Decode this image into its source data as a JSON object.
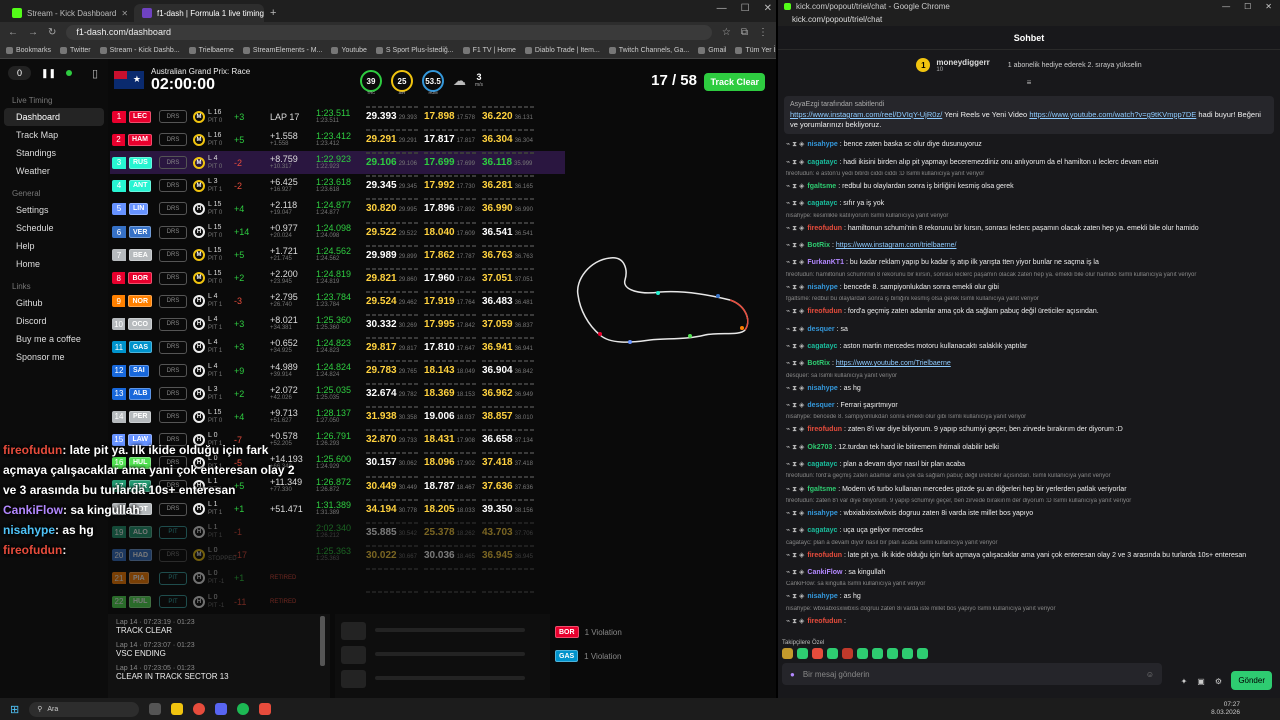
{
  "left_window": {
    "tabs": [
      {
        "label": "Stream - Kick Dashboard",
        "color": "#53fc18"
      },
      {
        "label": "f1-dash | Formula 1 live timing",
        "color": "#6f42c1"
      }
    ],
    "url": "f1-dash.com/dashboard",
    "bookmarks": [
      "Bookmarks",
      "Twitter",
      "Stream - Kick Dashb...",
      "Trielbaerne",
      "StreamElements - M...",
      "Youtube",
      "S Sport Plus-İstediğ...",
      "F1 TV | Home",
      "Diablo Trade | Item...",
      "Twitch Channels, Ga...",
      "Gmail",
      "Tüm Yer İşaretleri"
    ],
    "win_controls": [
      "—",
      "☐",
      "✕"
    ]
  },
  "sidebar": {
    "counter": "0",
    "live_timing": "Live Timing",
    "items": [
      "Dashboard",
      "Track Map",
      "Standings",
      "Weather"
    ],
    "general": "General",
    "general_items": [
      "Settings",
      "Schedule",
      "Help",
      "Home"
    ],
    "links": "Links",
    "link_items": [
      "Github",
      "Discord",
      "Buy me a coffee",
      "Sponsor me"
    ]
  },
  "race": {
    "name": "Australian Grand Prix: Race",
    "time": "02:00:00",
    "gauges": [
      {
        "value": "39",
        "label": "TRC"
      },
      {
        "value": "25",
        "label": "AIR"
      },
      {
        "value": "53.5",
        "label": "HUM"
      }
    ],
    "wind_value": "3",
    "wind_unit": "m/s",
    "laps": "17 / 58",
    "track_status": "Track Clear"
  },
  "drivers": [
    {
      "pos": "1",
      "code": "LEC",
      "color": "#e8002d",
      "drs": "DRS",
      "tyre": "M",
      "lap": "L 16",
      "pit": "PIT 0",
      "gain": "+3",
      "gap": "LAP 17",
      "gap2": "",
      "lt": "1:23.511",
      "lt2": "1:23.511",
      "s1": "29.393",
      "s1b": "29.393",
      "s2": "17.898",
      "s2b": "17.578",
      "s3": "36.220",
      "s3b": "36.131"
    },
    {
      "pos": "2",
      "code": "HAM",
      "color": "#e8002d",
      "drs": "DRS",
      "tyre": "M",
      "lap": "L 16",
      "pit": "PIT 0",
      "gain": "+5",
      "gap": "+1.558",
      "gap2": "+1.558",
      "lt": "1:23.412",
      "lt2": "1:23.412",
      "s1": "29.291",
      "s1b": "29.291",
      "s2": "17.817",
      "s2b": "17.817",
      "s3": "36.304",
      "s3b": "36.304"
    },
    {
      "pos": "3",
      "code": "RUS",
      "color": "#27f4d2",
      "drs": "DRS",
      "tyre": "M",
      "lap": "L 4",
      "pit": "PIT 0",
      "gain": "-2",
      "gap": "+8.759",
      "gap2": "+10.317",
      "lt": "1:22.923",
      "lt2": "1:22.923",
      "s1": "29.106",
      "s1b": "29.106",
      "s2": "17.699",
      "s2b": "17.699",
      "s3": "36.118",
      "s3b": "35.999"
    },
    {
      "pos": "4",
      "code": "ANT",
      "color": "#27f4d2",
      "drs": "DRS",
      "tyre": "M",
      "lap": "L 3",
      "pit": "PIT 1",
      "gain": "-2",
      "gap": "+6.425",
      "gap2": "+16.927",
      "lt": "1:23.618",
      "lt2": "1:23.618",
      "s1": "29.345",
      "s1b": "29.345",
      "s2": "17.992",
      "s2b": "17.730",
      "s3": "36.281",
      "s3b": "36.165"
    },
    {
      "pos": "5",
      "code": "LIN",
      "color": "#6692ff",
      "drs": "DRS",
      "tyre": "H",
      "lap": "L 15",
      "pit": "PIT 0",
      "gain": "+4",
      "gap": "+2.118",
      "gap2": "+19.047",
      "lt": "1:24.877",
      "lt2": "1:24.877",
      "s1": "30.820",
      "s1b": "29.995",
      "s2": "17.896",
      "s2b": "17.892",
      "s3": "36.990",
      "s3b": "36.990"
    },
    {
      "pos": "6",
      "code": "VER",
      "color": "#3671c6",
      "drs": "DRS",
      "tyre": "H",
      "lap": "L 15",
      "pit": "PIT 0",
      "gain": "+14",
      "gap": "+0.977",
      "gap2": "+20.024",
      "lt": "1:24.098",
      "lt2": "1:24.098",
      "s1": "29.522",
      "s1b": "29.522",
      "s2": "18.040",
      "s2b": "17.609",
      "s3": "36.541",
      "s3b": "36.541"
    },
    {
      "pos": "7",
      "code": "BEA",
      "color": "#b6babd",
      "drs": "DRS",
      "tyre": "M",
      "lap": "L 15",
      "pit": "PIT 0",
      "gain": "+5",
      "gap": "+1.721",
      "gap2": "+21.745",
      "lt": "1:24.562",
      "lt2": "1:24.562",
      "s1": "29.989",
      "s1b": "29.899",
      "s2": "17.862",
      "s2b": "17.787",
      "s3": "36.763",
      "s3b": "36.763"
    },
    {
      "pos": "8",
      "code": "BOR",
      "color": "#e8002d",
      "drs": "DRS",
      "tyre": "M",
      "lap": "L 15",
      "pit": "PIT 0",
      "gain": "+2",
      "gap": "+2.200",
      "gap2": "+23.945",
      "lt": "1:24.819",
      "lt2": "1:24.819",
      "s1": "29.821",
      "s1b": "29.860",
      "s2": "17.960",
      "s2b": "17.824",
      "s3": "37.051",
      "s3b": "37.051"
    },
    {
      "pos": "9",
      "code": "NOR",
      "color": "#ff8000",
      "drs": "DRS",
      "tyre": "H",
      "lap": "L 4",
      "pit": "PIT 1",
      "gain": "-3",
      "gap": "+2.795",
      "gap2": "+26.740",
      "lt": "1:23.784",
      "lt2": "1:23.784",
      "s1": "29.524",
      "s1b": "29.462",
      "s2": "17.919",
      "s2b": "17.764",
      "s3": "36.483",
      "s3b": "36.481"
    },
    {
      "pos": "10",
      "code": "OCO",
      "color": "#b6babd",
      "drs": "DRS",
      "tyre": "H",
      "lap": "L 4",
      "pit": "PIT 1",
      "gain": "+3",
      "gap": "+8.021",
      "gap2": "+34.381",
      "lt": "1:25.360",
      "lt2": "1:25.360",
      "s1": "30.332",
      "s1b": "30.269",
      "s2": "17.995",
      "s2b": "17.842",
      "s3": "37.059",
      "s3b": "36.837"
    },
    {
      "pos": "11",
      "code": "GAS",
      "color": "#0093cc",
      "drs": "DRS",
      "tyre": "H",
      "lap": "L 4",
      "pit": "PIT 1",
      "gain": "+3",
      "gap": "+0.652",
      "gap2": "+34.925",
      "lt": "1:24.823",
      "lt2": "1:24.823",
      "s1": "29.817",
      "s1b": "29.817",
      "s2": "17.810",
      "s2b": "17.647",
      "s3": "36.941",
      "s3b": "36.941"
    },
    {
      "pos": "12",
      "code": "SAI",
      "color": "#1868db",
      "drs": "DRS",
      "tyre": "H",
      "lap": "L 4",
      "pit": "PIT 1",
      "gain": "+9",
      "gap": "+4.989",
      "gap2": "+39.914",
      "lt": "1:24.824",
      "lt2": "1:24.824",
      "s1": "29.783",
      "s1b": "29.765",
      "s2": "18.143",
      "s2b": "18.049",
      "s3": "36.904",
      "s3b": "36.842"
    },
    {
      "pos": "13",
      "code": "ALB",
      "color": "#1868db",
      "drs": "DRS",
      "tyre": "H",
      "lap": "L 3",
      "pit": "PIT 1",
      "gain": "+2",
      "gap": "+2.072",
      "gap2": "+42.026",
      "lt": "1:25.035",
      "lt2": "1:25.035",
      "s1": "32.674",
      "s1b": "29.782",
      "s2": "18.369",
      "s2b": "18.153",
      "s3": "36.962",
      "s3b": "36.949"
    },
    {
      "pos": "14",
      "code": "PER",
      "color": "#b6babd",
      "drs": "DRS",
      "tyre": "H",
      "lap": "L 15",
      "pit": "PIT 0",
      "gain": "+4",
      "gap": "+9.713",
      "gap2": "+51.627",
      "lt": "1:28.137",
      "lt2": "1:27.050",
      "s1": "31.938",
      "s1b": "30.358",
      "s2": "19.006",
      "s2b": "18.037",
      "s3": "38.857",
      "s3b": "38.010"
    },
    {
      "pos": "15",
      "code": "LAW",
      "color": "#6692ff",
      "drs": "DRS",
      "tyre": "H",
      "lap": "L 0",
      "pit": "PIT 1",
      "gain": "-7",
      "gap": "+0.578",
      "gap2": "+52.205",
      "lt": "1:26.791",
      "lt2": "1:26.293",
      "s1": "32.870",
      "s1b": "29.733",
      "s2": "18.431",
      "s2b": "17.908",
      "s3": "36.658",
      "s3b": "37.134"
    },
    {
      "pos": "16",
      "code": "HUL",
      "color": "#52e252",
      "drs": "DRS",
      "tyre": "H",
      "lap": "L 0",
      "pit": "PIT 1",
      "gain": "-5",
      "gap": "+14.193",
      "gap2": "+66.349",
      "lt": "1:25.600",
      "lt2": "1:24.929",
      "s1": "30.157",
      "s1b": "30.062",
      "s2": "18.096",
      "s2b": "17.902",
      "s3": "37.418",
      "s3b": "37.418"
    },
    {
      "pos": "17",
      "code": "STR",
      "color": "#229971",
      "drs": "DRS",
      "tyre": "H",
      "lap": "L 1",
      "pit": "PIT 1",
      "gain": "+5",
      "gap": "+11.349",
      "gap2": "+77.330",
      "lt": "1:26.872",
      "lt2": "1:26.872",
      "s1": "30.449",
      "s1b": "30.449",
      "s2": "18.787",
      "s2b": "18.467",
      "s3": "37.636",
      "s3b": "37.636"
    },
    {
      "pos": "18",
      "code": "BOT",
      "color": "#b6babd",
      "drs": "DRS",
      "tyre": "H",
      "lap": "L 1",
      "pit": "PIT 1",
      "gain": "+1",
      "gap": "+51.471",
      "lt2": "1:31.389",
      "gap2": "",
      "lt": "1:31.389",
      "s1": "34.194",
      "s1b": "30.778",
      "s2": "18.205",
      "s2b": "18.033",
      "s3": "39.350",
      "s3b": "38.156"
    },
    {
      "pos": "19",
      "code": "ALO",
      "color": "#229971",
      "drs": "PIT",
      "tyre": "H",
      "lap": "L 1",
      "pit": "PIT 1",
      "gain": "-1",
      "gap": "",
      "gap2": "",
      "lt": "2:02.340",
      "lt2": "1:26.212",
      "s1": "35.885",
      "s1b": "30.542",
      "s2": "25.378",
      "s2b": "18.262",
      "s3": "43.703",
      "s3b": "37.706",
      "dim": true
    },
    {
      "pos": "20",
      "code": "HAD",
      "color": "#3671c6",
      "drs": "DRS",
      "tyre": "M",
      "lap": "L 0",
      "pit": "STOPPED",
      "gain": "-17",
      "gap": "",
      "gap2": "",
      "lt": "1:25.363",
      "lt2": "1:25.363",
      "s1": "30.022",
      "s1b": "30.667",
      "s2": "30.036",
      "s2b": "18.465",
      "s3": "36.945",
      "s3b": "36.945",
      "dim": true
    },
    {
      "pos": "21",
      "code": "PIA",
      "color": "#ff8000",
      "drs": "PIT",
      "tyre": "H",
      "lap": "L 0",
      "pit": "PIT -1",
      "gain": "+1",
      "gap": "",
      "gap2": "",
      "lt": "",
      "lt2": "",
      "s1": "",
      "s1b": "",
      "s2": "",
      "s2b": "",
      "s3": "",
      "s3b": "",
      "retired": "RETIRED"
    },
    {
      "pos": "22",
      "code": "HUL",
      "color": "#52e252",
      "drs": "PIT",
      "tyre": "H",
      "lap": "L 0",
      "pit": "PIT -1",
      "gain": "-11",
      "gap": "",
      "gap2": "",
      "lt": "",
      "lt2": "",
      "s1": "",
      "s1b": "",
      "s2": "",
      "s2b": "",
      "s3": "",
      "s3b": "",
      "retired": "RETIRED"
    }
  ],
  "race_control": [
    {
      "time": "Lap 14 · 07:23:19 · 01:23",
      "text": "TRACK CLEAR"
    },
    {
      "time": "Lap 14 · 07:23:07 · 01:23",
      "text": "VSC ENDING"
    },
    {
      "time": "Lap 14 · 07:23:05 · 01:23",
      "text": "CLEAR IN TRACK SECTOR 13"
    }
  ],
  "violations": [
    {
      "code": "BOR",
      "color": "#e8002d",
      "text": "1 Violation"
    },
    {
      "code": "GAS",
      "color": "#0093cc",
      "text": "1 Violation"
    }
  ],
  "overlay": {
    "l1_user": "fireofudun",
    "l1_text": ": late pit ya. ilk ikide olduğu için fark",
    "l2": "açmaya çalışacaklar ama yani çok enteresan olay 2",
    "l3": "ve 3 arasında bu turlarda 10s+ enteresan",
    "l4_user": "CankiFlow",
    "l4_text": ": sa kingullah",
    "l5_user": "nisahype",
    "l5_text": ": as hg",
    "l6_user": "fireofudun",
    "l6_text": ":"
  },
  "chat": {
    "window_title": "kick.com/popout/triel/chat - Google Chrome",
    "url": "kick.com/popout/triel/chat",
    "header": "Sohbet",
    "gift_user": "moneydiggerr",
    "gift_count": "10",
    "gift_text": "1 abonelik hediye ederek 2. sıraya yükselin",
    "pinned_by": "AsyaEzgi tarafından sabitlendi",
    "pinned_link1": "https://www.instagram.com/reel/DVIqY-UjR0z/",
    "pinned_mid": " Yeni Reels ve Yeni Video ",
    "pinned_link2": "https://www.youtube.com/watch?v=g9tKVmpp7DE",
    "pinned_end": " hadi buyur! Beğeni ve yorumlarınızı bekliyoruz.",
    "messages": [
      {
        "u": "nisahype",
        "c": "c4",
        "t": "bence zaten baska sc olur diye dusunuyoruz"
      },
      {
        "u": "cagatayc",
        "c": "c5",
        "t": "hadi ikisini birden alıp pit yapmayı beceremezdiniz onu anlıyorum da el hamilton u leclerc devam etsin"
      },
      {
        "r": "fireofudun: e aston'u yedi bitirdi ciddi ciddi :D İsimli kullanıcıya yanıt veriyor"
      },
      {
        "u": "fgaltsme",
        "c": "c2",
        "t": "redbul bu olaylardan sonra iş birliğini kesmiş olsa gerek"
      },
      {
        "u": "cagatayc",
        "c": "c5",
        "t": "sıfır ya iş yok"
      },
      {
        "r": "nisahype: kesinlikle katılıyorum İsimli kullanıcıya yanıt veriyor"
      },
      {
        "u": "fireofudun",
        "c": "c1",
        "t": "hamiltonun schumi'nin 8 rekorunu bir kırsın, sonrası leclerc paşamın olacak zaten hep ya. emekli bile olur hamido"
      },
      {
        "u": "BotRix",
        "c": "c2",
        "t": "https://www.instagram.com/trielbaerne/",
        "link": true
      },
      {
        "u": "FurkanKT1",
        "c": "c7",
        "t": "bu kadar reklam yapıp bu kadar iş atıp ilk yarışta tten yiyor bunlar ne saçma iş la"
      },
      {
        "r": "fireofudun: hamiltonun schumi'nin 8 rekorunu bir kırsın, sonrası leclerc paşamın olacak zaten hep ya. emekli bile olur hamido İsimli kullanıcıya yanıt veriyor"
      },
      {
        "u": "nisahype",
        "c": "c4",
        "t": "bencede 8. sampiyonlukdan sonra emekli olur gibi"
      },
      {
        "r": "fgaltsme: redbul bu olaylardan sonra iş birliğini kesmiş olsa gerek İsimli kullanıcıya yanıt veriyor"
      },
      {
        "u": "fireofudun",
        "c": "c1",
        "t": "ford'a geçmiş zaten adamlar ama çok da sağlam pabuç değil üreticiler açısından."
      },
      {
        "u": "desquer",
        "c": "c4",
        "t": "sa"
      },
      {
        "u": "cagatayc",
        "c": "c5",
        "t": "aston martin mercedes motoru kullanacaktı salaklık yaptılar"
      },
      {
        "u": "BotRix",
        "c": "c2",
        "t": "https://www.youtube.com/Trielbaerne",
        "link": true
      },
      {
        "r": "desquer: sa İsimli kullanıcıya yanıt veriyor"
      },
      {
        "u": "nisahype",
        "c": "c4",
        "t": "as hg"
      },
      {
        "u": "desquer",
        "c": "c4",
        "t": "Ferrari şaşırtmıyor"
      },
      {
        "r": "nisahype: bencede 8. sampiyonlukdan sonra emekli olur gibi İsimli kullanıcıya yanıt veriyor"
      },
      {
        "u": "fireofudun",
        "c": "c1",
        "t": "zaten 8'i var diye biliyorum. 9 yapıp schumiyi geçer, ben zirvede bırakırım der diyorum :D"
      },
      {
        "u": "Ok2703",
        "c": "c2",
        "t": "12.turdan tek hard ile bitiremem ihtimali olabilir belki"
      },
      {
        "u": "cagatayc",
        "c": "c5",
        "t": "plan a devam diyor nasıl bir plan acaba"
      },
      {
        "r": "fireofudun: ford'a geçmiş zaten adamlar ama çok da sağlam pabuç değil üreticiler açısından. İsimli kullanıcıya yanıt veriyor"
      },
      {
        "u": "fgaltsme",
        "c": "c2",
        "t": "Modern v6 turbo kullanan mercedes gözde şu an diğerleri hep bir yerlerden patlak veriyorlar"
      },
      {
        "r": "fireofudun: zaten 8'i var diye biliyorum. 9 yapıp schumiyi geçer, ben zirvede bırakırım der diyorum :D İsimli kullanıcıya yanıt veriyor"
      },
      {
        "u": "nisahype",
        "c": "c4",
        "t": "wbxiabxisxiwbxis dogruu zaten 8i varda iste millet bos yapıyo"
      },
      {
        "u": "cagatayc",
        "c": "c5",
        "t": "uça uça geliyor mercedes"
      },
      {
        "r": "cagatayc: plan a devam diyor nasıl bir plan acaba İsimli kullanıcıya yanıt veriyor"
      },
      {
        "u": "fireofudun",
        "c": "c1",
        "t": "late pit ya. ilk ikide olduğu için fark açmaya çalışacaklar ama yani çok enteresan olay 2 ve 3 arasında bu turlarda 10s+ enteresan"
      },
      {
        "u": "CankiFlow",
        "c": "c7",
        "t": "sa kingullah"
      },
      {
        "r": "CankiFlow: sa kingulla İsimli kullanıcıya yanıt veriyor"
      },
      {
        "u": "nisahype",
        "c": "c4",
        "t": "as hg"
      },
      {
        "r": "nisahype: wbxiabxisxiwbxis dogruu zaten 8i varda iste millet bos yapıyo İsimli kullanıcıya yanıt veriyor"
      },
      {
        "u": "fireofudun",
        "c": "c1",
        "t": ""
      }
    ],
    "followers_label": "Takipçilere Özel",
    "input_placeholder": "Bir mesaj gönderin",
    "send": "Gönder"
  },
  "taskbar": {
    "search": "Ara",
    "time": "07:27",
    "date": "8.03.2026"
  }
}
